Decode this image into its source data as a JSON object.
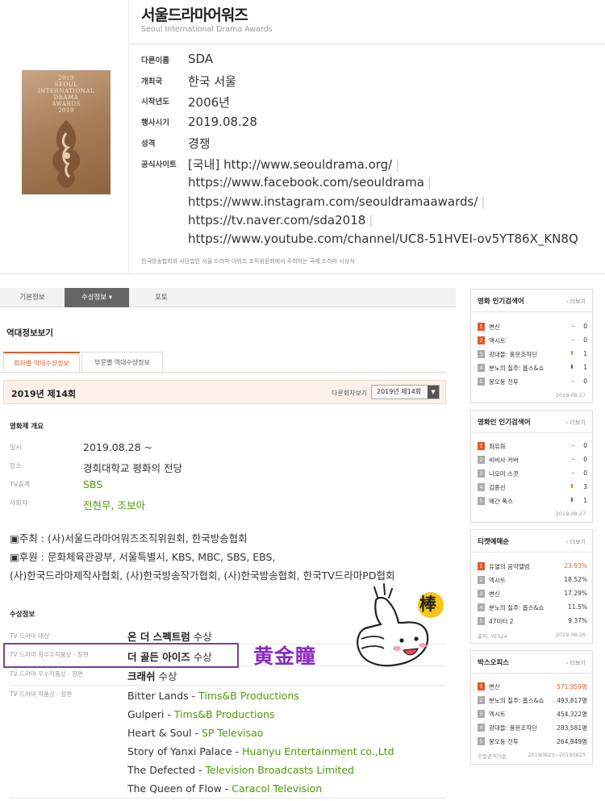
{
  "top": {
    "title": "서울드라마어워즈",
    "subtitle": "Seoul International Drama Awards",
    "poster_lines": [
      "2019",
      "SEOUL",
      "INTERNATIONAL",
      "DRAMA",
      "AWARDS",
      "2019"
    ],
    "info": [
      {
        "label": "다른이름",
        "value": "SDA"
      },
      {
        "label": "개최국",
        "value": "한국 서울"
      },
      {
        "label": "시작년도",
        "value": "2006년"
      },
      {
        "label": "행사시기",
        "value": "2019.08.28"
      },
      {
        "label": "성격",
        "value": "경쟁"
      },
      {
        "label": "공식사이트",
        "value": "[국내] http://www.seouldrama.org/"
      }
    ],
    "sites": [
      "https://www.facebook.com/seouldrama",
      "https://www.instagram.com/seouldramaawards/",
      "https://tv.naver.com/sda2018",
      "https://www.youtube.com/channel/UC8-51HVEI-ov5YT86X_KN8Q"
    ],
    "footnote": "한국방송협회와 사단법인 서울 드라마 어워즈 조직위원회에서 주최하는 국제 드라마 시상식"
  },
  "tabs": [
    "기본정보",
    "수상정보 ▾",
    "포토"
  ],
  "history_title": "역대정보보기",
  "subtabs": [
    "회차별 역대수상정보",
    "부문별 역대수상정보"
  ],
  "edition": {
    "title": "2019년 제14회",
    "other_label": "다른회차보기",
    "selected": "2019년 제14회"
  },
  "overview": {
    "heading": "영화제 개요",
    "rows": [
      {
        "label": "일시",
        "value": "2019.08.28 ~"
      },
      {
        "label": "장소",
        "value": "경희대학교 평화의 전당"
      },
      {
        "label": "TV중계",
        "value": "SBS"
      },
      {
        "label": "사회자",
        "value": "전현무, 조보아"
      }
    ],
    "notes": [
      "▣주최 : (사)서울드라마어워즈조직위원회, 한국방송협회",
      "▣후원 : 문화체육관광부, 서울특별시, KBS, MBC, SBS, EBS,",
      "(사)한국드라마제작사협회, (사)한국방송작가협회, (사)한국방송협회, 한국TV드라마PD협회"
    ]
  },
  "awards": {
    "heading": "수상정보",
    "rows": [
      {
        "label": "TV 드라마 대상",
        "title": "온 더 스펙트럼",
        "suffix": " 수상"
      },
      {
        "label": "TV 드라마 최우수작품상 - 장편",
        "title": "더 골든 아이즈",
        "suffix": " 수상"
      },
      {
        "label": "TV 드라마 우수작품상 - 장편",
        "title": "크래쉬",
        "suffix": " 수상"
      }
    ],
    "nominee_label": "TV 드라마 작품상 - 장편",
    "nominees": [
      {
        "title": "Bitter Lands",
        "company": "Tims&B Productions"
      },
      {
        "title": "Gulperi",
        "company": "Tims&B Productions"
      },
      {
        "title": "Heart & Soul",
        "company": "SP Televisao"
      },
      {
        "title": "Story of Yanxi Palace",
        "company": "Huanyu Entertainment co.,Ltd"
      },
      {
        "title": "The Defected",
        "company": "Television Broadcasts Limited"
      },
      {
        "title": "The Queen of Flow",
        "company": "Caracol Television"
      }
    ]
  },
  "annotation": {
    "text": "黄金瞳",
    "sticker": "棒"
  },
  "panels": {
    "movie_search": {
      "title": "영화 인기검색어",
      "more": "› 더보기",
      "items": [
        {
          "rank": "1",
          "name": "변신",
          "trend": "",
          "value": "0"
        },
        {
          "rank": "2",
          "name": "엑시트",
          "trend": "",
          "value": "0"
        },
        {
          "rank": "3",
          "name": "광대들: 풍문조작단",
          "trend": "up",
          "value": "1"
        },
        {
          "rank": "4",
          "name": "분노의 질주: 홉스&쇼",
          "trend": "down",
          "value": "1"
        },
        {
          "rank": "5",
          "name": "봉오동 전투",
          "trend": "",
          "value": "0"
        }
      ],
      "date": "2019.08.27"
    },
    "person_search": {
      "title": "영화인 인기검색어",
      "more": "› 더보기",
      "items": [
        {
          "rank": "1",
          "name": "최유화",
          "trend": "",
          "value": "0"
        },
        {
          "rank": "2",
          "name": "비비사 커버",
          "trend": "",
          "value": "0"
        },
        {
          "rank": "3",
          "name": "나오미 스콧",
          "trend": "",
          "value": "0"
        },
        {
          "rank": "4",
          "name": "김홍선",
          "trend": "up",
          "value": "3"
        },
        {
          "rank": "5",
          "name": "메간 폭스",
          "trend": "down",
          "value": "1"
        }
      ],
      "date": "2019.08.27"
    },
    "ticket": {
      "title": "티켓예매순",
      "more": "› 더보기",
      "items": [
        {
          "rank": "1",
          "name": "유열의 음악앨범",
          "value": "23.93%"
        },
        {
          "rank": "2",
          "name": "엑시트",
          "value": "18.52%"
        },
        {
          "rank": "3",
          "name": "변신",
          "value": "17.29%"
        },
        {
          "rank": "4",
          "name": "분노의 질주: 홉스&쇼",
          "value": "11.5%"
        },
        {
          "rank": "5",
          "name": "47미터 2",
          "value": "9.37%"
        }
      ],
      "source": "출처: YES24",
      "date": "2019.08.26"
    },
    "boxoffice": {
      "title": "박스오피스",
      "more": "› 더보기",
      "items": [
        {
          "rank": "1",
          "name": "변신",
          "value": "571,959명"
        },
        {
          "rank": "2",
          "name": "분노의 질주: 홉스&쇼",
          "value": "493,817명"
        },
        {
          "rank": "3",
          "name": "엑시트",
          "value": "454,322명"
        },
        {
          "rank": "4",
          "name": "광대들: 풍문조작단",
          "value": "283,581명"
        },
        {
          "rank": "5",
          "name": "봉오동 전투",
          "value": "264,849명"
        }
      ],
      "period_label": "주말관객기준",
      "period": "20190823~20190825"
    }
  },
  "colors": {
    "accent": "#e05a29",
    "green": "#4e9a06",
    "annotation": "#8a2bbf"
  }
}
